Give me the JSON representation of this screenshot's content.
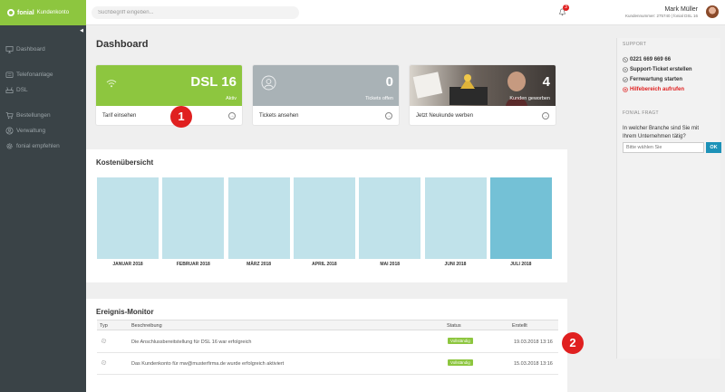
{
  "brand": {
    "name": "fonial",
    "product": "Kundenkonto"
  },
  "search": {
    "placeholder": "Suchbegriff eingeben..."
  },
  "notifications": {
    "count": "3"
  },
  "user": {
    "name": "Mark Müller",
    "meta": "Kundennummer: 275740 | fonial DSL 16"
  },
  "sidebar": {
    "collapse": "◀",
    "items": [
      {
        "label": "Dashboard",
        "icon": "desktop-icon"
      },
      {
        "label": "Telefonanlage",
        "icon": "phone-icon"
      },
      {
        "label": "DSL",
        "icon": "router-icon"
      },
      {
        "label": "Bestellungen",
        "icon": "cart-icon"
      },
      {
        "label": "Verwaltung",
        "icon": "user-icon"
      },
      {
        "label": "fonial empfehlen",
        "icon": "gear-icon"
      }
    ]
  },
  "page": {
    "title": "Dashboard"
  },
  "cards": [
    {
      "value": "DSL 16",
      "caption": "Aktiv",
      "link": "Tarif einsehen",
      "color": "#8dc63f",
      "icon": "wifi-icon"
    },
    {
      "value": "0",
      "caption": "Tickets offen",
      "link": "Tickets ansehen",
      "color": "#a9b2b6",
      "icon": "user-circle-icon"
    },
    {
      "value": "4",
      "caption": "Kunden geworben",
      "link": "Jetzt Neukunde werben",
      "color": "#4a4440",
      "icon": "gift-photo"
    }
  ],
  "costs": {
    "title": "Kostenübersicht",
    "months": [
      "JANUAR 2018",
      "FEBRUAR 2018",
      "MÄRZ 2018",
      "APRIL 2018",
      "MAI 2018",
      "JUNI 2018",
      "JULI 2018"
    ]
  },
  "chart_data": {
    "type": "bar",
    "title": "Kostenübersicht",
    "categories": [
      "JANUAR 2018",
      "FEBRUAR 2018",
      "MÄRZ 2018",
      "APRIL 2018",
      "MAI 2018",
      "JUNI 2018",
      "JULI 2018"
    ],
    "values": [
      1,
      1,
      1,
      1,
      1,
      1,
      1
    ],
    "highlight_index": 6,
    "colors": {
      "bar": "#c0e2ea",
      "current": "#74c1d6"
    }
  },
  "events": {
    "title": "Ereignis-Monitor",
    "columns": [
      "Typ",
      "Beschreibung",
      "Status",
      "Erstellt"
    ],
    "rows": [
      {
        "description": "Die Anschlussbereitstellung für DSL 16 war erfolgreich",
        "status": "Vollständig",
        "created": "19.03.2018 13:16"
      },
      {
        "description": "Das Kundenkonto für mw@musterfirma.de wurde erfolgreich aktiviert",
        "status": "Vollständig",
        "created": "15.03.2018 13:16"
      }
    ]
  },
  "markers": [
    "1",
    "2"
  ],
  "support": {
    "heading": "SUPPORT",
    "phone": "0221 669 669 66",
    "ticket": "Support-Ticket erstellen",
    "remote": "Fernwartung starten",
    "help": "Hilfebereich aufrufen",
    "help_color": "#e02020"
  },
  "question": {
    "heading": "FONIAL FRAGT",
    "text": "In welcher Branche sind Sie mit Ihrem Unternehmen tätig?",
    "placeholder": "Bitte wählen Sie",
    "button": "OK"
  }
}
